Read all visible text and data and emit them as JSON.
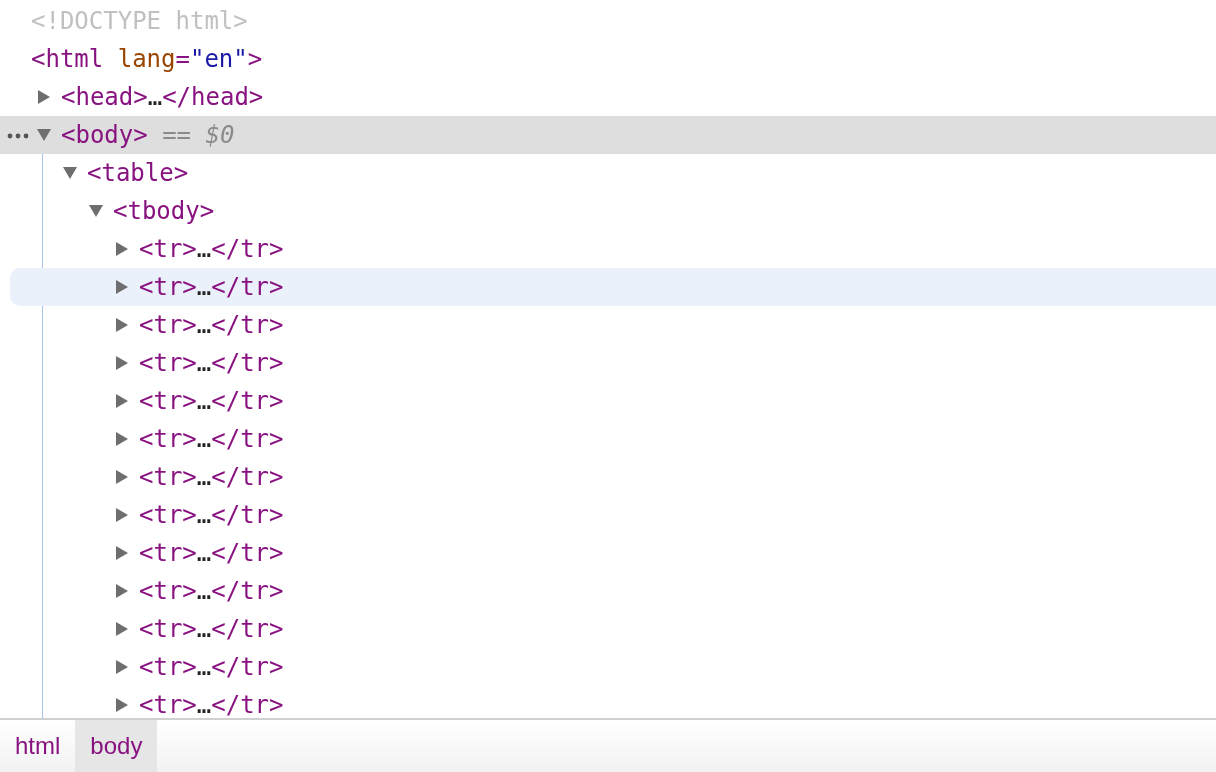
{
  "tree": [
    {
      "selected": false,
      "hovered": false,
      "parts": [
        {
          "kind": "doctype",
          "text": "<!DOCTYPE html>"
        }
      ]
    },
    {
      "selected": false,
      "hovered": false,
      "parts": [
        {
          "kind": "tag",
          "text": "<html"
        },
        {
          "kind": "attr_name",
          "text": "lang"
        },
        {
          "kind": "tag",
          "text": "="
        },
        {
          "kind": "attr_value",
          "text": "\"en\""
        },
        {
          "kind": "tag",
          "text": ">"
        }
      ],
      "children": [
        {
          "expanded": false,
          "selected": false,
          "hovered": false,
          "parts": [
            {
              "kind": "tag",
              "text": "<head>"
            },
            {
              "kind": "ellipsis",
              "text": "…"
            },
            {
              "kind": "tag",
              "text": "</head>"
            }
          ]
        },
        {
          "expanded": true,
          "selected": true,
          "hovered": false,
          "parts": [
            {
              "kind": "tag",
              "text": "<body>"
            },
            {
              "kind": "marker",
              "text": "== $0"
            }
          ],
          "children": [
            {
              "expanded": true,
              "selected": false,
              "hovered": false,
              "parts": [
                {
                  "kind": "tag",
                  "text": "<table>"
                }
              ],
              "children": [
                {
                  "expanded": true,
                  "selected": false,
                  "hovered": false,
                  "parts": [
                    {
                      "kind": "tag",
                      "text": "<tbody>"
                    }
                  ],
                  "children": [
                    {
                      "expanded": false,
                      "selected": false,
                      "hovered": false,
                      "parts": [
                        {
                          "kind": "tag",
                          "text": "<tr>"
                        },
                        {
                          "kind": "ellipsis",
                          "text": "…"
                        },
                        {
                          "kind": "tag",
                          "text": "</tr>"
                        }
                      ]
                    },
                    {
                      "expanded": false,
                      "selected": false,
                      "hovered": true,
                      "parts": [
                        {
                          "kind": "tag",
                          "text": "<tr>"
                        },
                        {
                          "kind": "ellipsis",
                          "text": "…"
                        },
                        {
                          "kind": "tag",
                          "text": "</tr>"
                        }
                      ]
                    },
                    {
                      "expanded": false,
                      "selected": false,
                      "hovered": false,
                      "parts": [
                        {
                          "kind": "tag",
                          "text": "<tr>"
                        },
                        {
                          "kind": "ellipsis",
                          "text": "…"
                        },
                        {
                          "kind": "tag",
                          "text": "</tr>"
                        }
                      ]
                    },
                    {
                      "expanded": false,
                      "selected": false,
                      "hovered": false,
                      "parts": [
                        {
                          "kind": "tag",
                          "text": "<tr>"
                        },
                        {
                          "kind": "ellipsis",
                          "text": "…"
                        },
                        {
                          "kind": "tag",
                          "text": "</tr>"
                        }
                      ]
                    },
                    {
                      "expanded": false,
                      "selected": false,
                      "hovered": false,
                      "parts": [
                        {
                          "kind": "tag",
                          "text": "<tr>"
                        },
                        {
                          "kind": "ellipsis",
                          "text": "…"
                        },
                        {
                          "kind": "tag",
                          "text": "</tr>"
                        }
                      ]
                    },
                    {
                      "expanded": false,
                      "selected": false,
                      "hovered": false,
                      "parts": [
                        {
                          "kind": "tag",
                          "text": "<tr>"
                        },
                        {
                          "kind": "ellipsis",
                          "text": "…"
                        },
                        {
                          "kind": "tag",
                          "text": "</tr>"
                        }
                      ]
                    },
                    {
                      "expanded": false,
                      "selected": false,
                      "hovered": false,
                      "parts": [
                        {
                          "kind": "tag",
                          "text": "<tr>"
                        },
                        {
                          "kind": "ellipsis",
                          "text": "…"
                        },
                        {
                          "kind": "tag",
                          "text": "</tr>"
                        }
                      ]
                    },
                    {
                      "expanded": false,
                      "selected": false,
                      "hovered": false,
                      "parts": [
                        {
                          "kind": "tag",
                          "text": "<tr>"
                        },
                        {
                          "kind": "ellipsis",
                          "text": "…"
                        },
                        {
                          "kind": "tag",
                          "text": "</tr>"
                        }
                      ]
                    },
                    {
                      "expanded": false,
                      "selected": false,
                      "hovered": false,
                      "parts": [
                        {
                          "kind": "tag",
                          "text": "<tr>"
                        },
                        {
                          "kind": "ellipsis",
                          "text": "…"
                        },
                        {
                          "kind": "tag",
                          "text": "</tr>"
                        }
                      ]
                    },
                    {
                      "expanded": false,
                      "selected": false,
                      "hovered": false,
                      "parts": [
                        {
                          "kind": "tag",
                          "text": "<tr>"
                        },
                        {
                          "kind": "ellipsis",
                          "text": "…"
                        },
                        {
                          "kind": "tag",
                          "text": "</tr>"
                        }
                      ]
                    },
                    {
                      "expanded": false,
                      "selected": false,
                      "hovered": false,
                      "parts": [
                        {
                          "kind": "tag",
                          "text": "<tr>"
                        },
                        {
                          "kind": "ellipsis",
                          "text": "…"
                        },
                        {
                          "kind": "tag",
                          "text": "</tr>"
                        }
                      ]
                    },
                    {
                      "expanded": false,
                      "selected": false,
                      "hovered": false,
                      "parts": [
                        {
                          "kind": "tag",
                          "text": "<tr>"
                        },
                        {
                          "kind": "ellipsis",
                          "text": "…"
                        },
                        {
                          "kind": "tag",
                          "text": "</tr>"
                        }
                      ]
                    },
                    {
                      "expanded": false,
                      "selected": false,
                      "hovered": false,
                      "parts": [
                        {
                          "kind": "tag",
                          "text": "<tr>"
                        },
                        {
                          "kind": "ellipsis",
                          "text": "…"
                        },
                        {
                          "kind": "tag",
                          "text": "</tr>"
                        }
                      ]
                    }
                  ]
                }
              ]
            }
          ]
        }
      ]
    }
  ],
  "breadcrumbs": [
    {
      "label": "html",
      "selected": false
    },
    {
      "label": "body",
      "selected": true
    }
  ]
}
